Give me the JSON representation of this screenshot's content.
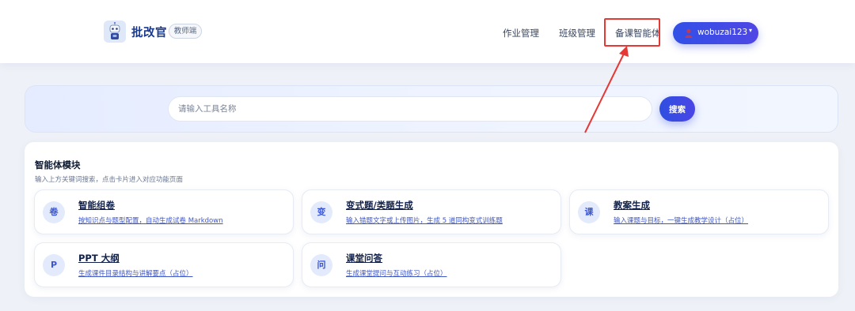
{
  "header": {
    "brand": "批改官",
    "role_badge": "教师端",
    "nav": [
      {
        "label": "作业管理"
      },
      {
        "label": "班级管理"
      },
      {
        "label": "备课智能体"
      }
    ],
    "user": {
      "name": "wobuzai123",
      "caret": "▾"
    }
  },
  "search": {
    "placeholder": "请输入工具名称",
    "value": "",
    "button_label": "搜索"
  },
  "modules": {
    "title": "智能体模块",
    "subtitle": "输入上方关键词搜索，点击卡片进入对应功能页面",
    "cards": [
      {
        "icon_char": "卷",
        "title": "智能组卷",
        "desc": "按知识点与题型配置，自动生成试卷 Markdown"
      },
      {
        "icon_char": "变",
        "title": "变式题/类题生成",
        "desc": "输入错题文字或上传图片，生成 5 道同构变式训练题"
      },
      {
        "icon_char": "课",
        "title": "教案生成",
        "desc": "输入课题与目标，一键生成教学设计（占位）"
      },
      {
        "icon_char": "P",
        "title": "PPT 大纲",
        "desc": "生成课件目录结构与讲解要点（占位）"
      },
      {
        "icon_char": "问",
        "title": "课堂问答",
        "desc": "生成课堂提问与互动练习（占位）"
      }
    ]
  },
  "colors": {
    "accent": "#3a4fe0",
    "highlight_annotation": "#e53935",
    "brand_text": "#1b3a8c"
  }
}
